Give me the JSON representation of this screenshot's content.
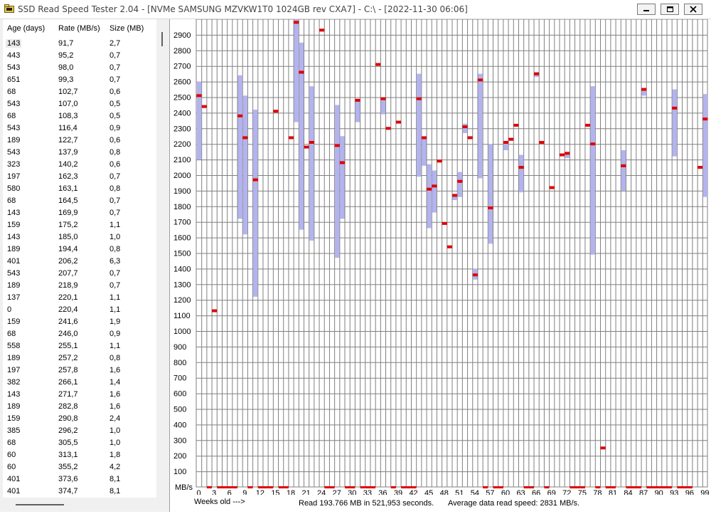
{
  "window": {
    "title": "SSD Read Speed Tester 2.04 - [NVMe SAMSUNG MZVKW1T0 1024GB rev CXA7] - C:\\ - [2022-11-30 06:06]"
  },
  "colors": {
    "range_bar": "#b3b3f0",
    "median_mark": "#e00000",
    "grid": "#808080"
  },
  "file_list": {
    "columns": [
      "Age (days)",
      "Rate (MB/s)",
      "Size (MB)"
    ],
    "rows": [
      [
        "143",
        "91,7",
        "2,7"
      ],
      [
        "443",
        "95,2",
        "0,7"
      ],
      [
        "543",
        "98,0",
        "0,7"
      ],
      [
        "651",
        "99,3",
        "0,7"
      ],
      [
        "68",
        "102,7",
        "0,6"
      ],
      [
        "543",
        "107,0",
        "0,5"
      ],
      [
        "68",
        "108,3",
        "0,5"
      ],
      [
        "543",
        "116,4",
        "0,9"
      ],
      [
        "189",
        "122,7",
        "0,6"
      ],
      [
        "543",
        "137,9",
        "0,8"
      ],
      [
        "323",
        "140,2",
        "0,6"
      ],
      [
        "197",
        "162,3",
        "0,7"
      ],
      [
        "580",
        "163,1",
        "0,8"
      ],
      [
        "68",
        "164,5",
        "0,7"
      ],
      [
        "143",
        "169,9",
        "0,7"
      ],
      [
        "159",
        "175,2",
        "1,1"
      ],
      [
        "143",
        "185,0",
        "1,0"
      ],
      [
        "189",
        "194,4",
        "0,8"
      ],
      [
        "401",
        "206,2",
        "6,3"
      ],
      [
        "543",
        "207,7",
        "0,7"
      ],
      [
        "189",
        "218,9",
        "0,7"
      ],
      [
        "137",
        "220,1",
        "1,1"
      ],
      [
        "0",
        "220,4",
        "1,1"
      ],
      [
        "159",
        "241,6",
        "1,9"
      ],
      [
        "68",
        "246,0",
        "0,9"
      ],
      [
        "558",
        "255,1",
        "1,1"
      ],
      [
        "189",
        "257,2",
        "0,8"
      ],
      [
        "197",
        "257,8",
        "1,6"
      ],
      [
        "382",
        "266,1",
        "1,4"
      ],
      [
        "143",
        "271,7",
        "1,6"
      ],
      [
        "189",
        "282,8",
        "1,6"
      ],
      [
        "159",
        "290,8",
        "2,4"
      ],
      [
        "385",
        "296,2",
        "1,0"
      ],
      [
        "68",
        "305,5",
        "1,0"
      ],
      [
        "60",
        "313,1",
        "1,8"
      ],
      [
        "60",
        "355,2",
        "4,2"
      ],
      [
        "401",
        "373,6",
        "8,1"
      ],
      [
        "401",
        "374,7",
        "8,1"
      ]
    ]
  },
  "chart_data": {
    "type": "bar",
    "ylabel": "MB/s",
    "xlabel": "Weeks old --->",
    "ylim": [
      0,
      3000
    ],
    "xlim": [
      0,
      99
    ],
    "y_ticks": [
      100,
      200,
      300,
      400,
      500,
      600,
      700,
      800,
      900,
      1000,
      1100,
      1200,
      1300,
      1400,
      1500,
      1600,
      1700,
      1800,
      1900,
      2000,
      2100,
      2200,
      2300,
      2400,
      2500,
      2600,
      2700,
      2800,
      2900
    ],
    "x_ticks": [
      0,
      3,
      6,
      9,
      12,
      15,
      18,
      21,
      24,
      27,
      30,
      33,
      36,
      39,
      42,
      45,
      48,
      51,
      54,
      57,
      60,
      63,
      66,
      69,
      72,
      75,
      78,
      81,
      84,
      87,
      90,
      93,
      96,
      99
    ],
    "grid": true,
    "ranges": [
      {
        "week": 0,
        "min": 2100,
        "max": 2600
      },
      {
        "week": 8,
        "min": 1720,
        "max": 2640
      },
      {
        "week": 9,
        "min": 1620,
        "max": 2510
      },
      {
        "week": 11,
        "min": 1220,
        "max": 2420
      },
      {
        "week": 19,
        "min": 2340,
        "max": 3000
      },
      {
        "week": 20,
        "min": 1650,
        "max": 2850
      },
      {
        "week": 22,
        "min": 1580,
        "max": 2570
      },
      {
        "week": 27,
        "min": 1470,
        "max": 2450
      },
      {
        "week": 28,
        "min": 1720,
        "max": 2250
      },
      {
        "week": 31,
        "min": 2340,
        "max": 2490
      },
      {
        "week": 36,
        "min": 2390,
        "max": 2490
      },
      {
        "week": 43,
        "min": 1990,
        "max": 2650
      },
      {
        "week": 44,
        "min": 2060,
        "max": 2240
      },
      {
        "week": 45,
        "min": 1660,
        "max": 2070
      },
      {
        "week": 46,
        "min": 1760,
        "max": 2030
      },
      {
        "week": 50,
        "min": 1840,
        "max": 1880
      },
      {
        "week": 51,
        "min": 1860,
        "max": 2020
      },
      {
        "week": 52,
        "min": 2270,
        "max": 2330
      },
      {
        "week": 54,
        "min": 1330,
        "max": 1400
      },
      {
        "week": 55,
        "min": 1980,
        "max": 2650
      },
      {
        "week": 57,
        "min": 1560,
        "max": 2200
      },
      {
        "week": 60,
        "min": 2160,
        "max": 2220
      },
      {
        "week": 61,
        "min": 2220,
        "max": 2240
      },
      {
        "week": 63,
        "min": 1890,
        "max": 2130
      },
      {
        "week": 66,
        "min": 2630,
        "max": 2660
      },
      {
        "week": 72,
        "min": 2110,
        "max": 2140
      },
      {
        "week": 77,
        "min": 1490,
        "max": 2570
      },
      {
        "week": 83,
        "min": 1900,
        "max": 2160
      },
      {
        "week": 87,
        "min": 2510,
        "max": 2550
      },
      {
        "week": 93,
        "min": 2120,
        "max": 2550
      },
      {
        "week": 99,
        "min": 1860,
        "max": 2520
      }
    ],
    "medians": [
      {
        "week": 0,
        "value": 2510
      },
      {
        "week": 1,
        "value": 2440
      },
      {
        "week": 3,
        "value": 1130
      },
      {
        "week": 8,
        "value": 2380
      },
      {
        "week": 9,
        "value": 2240
      },
      {
        "week": 11,
        "value": 1970
      },
      {
        "week": 15,
        "value": 2410
      },
      {
        "week": 18,
        "value": 2240
      },
      {
        "week": 19,
        "value": 2980
      },
      {
        "week": 20,
        "value": 2660
      },
      {
        "week": 21,
        "value": 2180
      },
      {
        "week": 22,
        "value": 2210
      },
      {
        "week": 24,
        "value": 2930
      },
      {
        "week": 27,
        "value": 2190
      },
      {
        "week": 28,
        "value": 2080
      },
      {
        "week": 31,
        "value": 2480
      },
      {
        "week": 35,
        "value": 2710
      },
      {
        "week": 36,
        "value": 2490
      },
      {
        "week": 37,
        "value": 2300
      },
      {
        "week": 39,
        "value": 2340
      },
      {
        "week": 43,
        "value": 2490
      },
      {
        "week": 44,
        "value": 2240
      },
      {
        "week": 45,
        "value": 1910
      },
      {
        "week": 46,
        "value": 1930
      },
      {
        "week": 47,
        "value": 2090
      },
      {
        "week": 48,
        "value": 1690
      },
      {
        "week": 49,
        "value": 1540
      },
      {
        "week": 50,
        "value": 1870
      },
      {
        "week": 51,
        "value": 1960
      },
      {
        "week": 52,
        "value": 2310
      },
      {
        "week": 53,
        "value": 2240
      },
      {
        "week": 54,
        "value": 1360
      },
      {
        "week": 55,
        "value": 2610
      },
      {
        "week": 57,
        "value": 1790
      },
      {
        "week": 60,
        "value": 2210
      },
      {
        "week": 61,
        "value": 2230
      },
      {
        "week": 62,
        "value": 2320
      },
      {
        "week": 63,
        "value": 2050
      },
      {
        "week": 66,
        "value": 2650
      },
      {
        "week": 67,
        "value": 2210
      },
      {
        "week": 69,
        "value": 1920
      },
      {
        "week": 71,
        "value": 2130
      },
      {
        "week": 72,
        "value": 2140
      },
      {
        "week": 76,
        "value": 2320
      },
      {
        "week": 77,
        "value": 2200
      },
      {
        "week": 79,
        "value": 250
      },
      {
        "week": 83,
        "value": 2060
      },
      {
        "week": 87,
        "value": 2550
      },
      {
        "week": 93,
        "value": 2430
      },
      {
        "week": 98,
        "value": 2050
      },
      {
        "week": 99,
        "value": 2360
      }
    ],
    "zero_weeks": [
      2,
      4,
      5,
      6,
      7,
      10,
      12,
      13,
      14,
      16,
      17,
      25,
      26,
      29,
      30,
      32,
      33,
      34,
      38,
      40,
      41,
      42,
      56,
      58,
      59,
      64,
      65,
      68,
      73,
      74,
      75,
      78,
      80,
      81,
      84,
      85,
      86,
      88,
      89,
      90,
      91,
      92,
      94,
      95,
      96
    ]
  },
  "status": {
    "weeks_label": "Weeks old --->",
    "read": "Read 193.766 MB in 521,953 seconds.",
    "average": "Average data read speed: 2831 MB/s."
  }
}
